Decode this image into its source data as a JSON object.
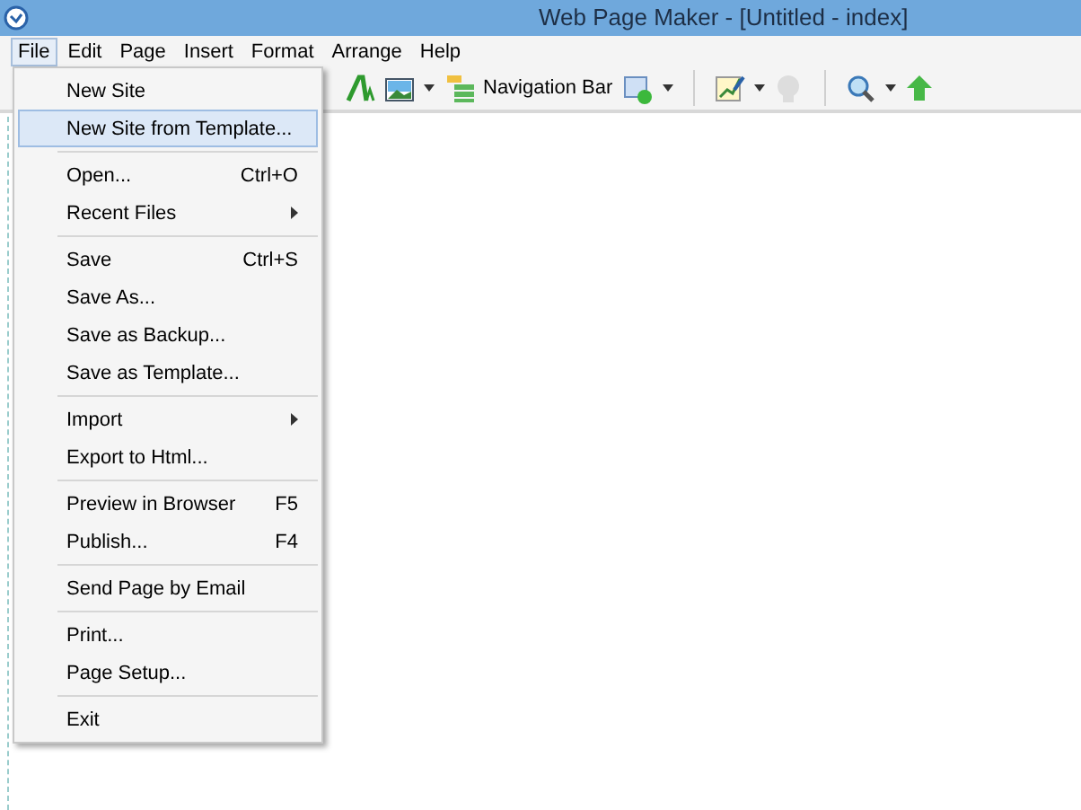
{
  "window": {
    "title": "Web Page Maker - [Untitled - index]"
  },
  "menubar": [
    {
      "label": "File",
      "selected": true
    },
    {
      "label": "Edit",
      "selected": false
    },
    {
      "label": "Page",
      "selected": false
    },
    {
      "label": "Insert",
      "selected": false
    },
    {
      "label": "Format",
      "selected": false
    },
    {
      "label": "Arrange",
      "selected": false
    },
    {
      "label": "Help",
      "selected": false
    }
  ],
  "toolbar": [
    {
      "kind": "icon"
    },
    {
      "kind": "icon"
    },
    {
      "kind": "caret"
    },
    {
      "kind": "labeled",
      "label": "Navigation Bar"
    },
    {
      "kind": "icon"
    },
    {
      "kind": "caret"
    },
    {
      "kind": "separator"
    },
    {
      "kind": "icon"
    },
    {
      "kind": "caret"
    },
    {
      "kind": "icon"
    },
    {
      "kind": "separator"
    },
    {
      "kind": "icon"
    },
    {
      "kind": "caret"
    },
    {
      "kind": "icon"
    }
  ],
  "file_menu": [
    {
      "kind": "item",
      "label": "New Site",
      "selected": false
    },
    {
      "kind": "item",
      "label": "New Site from Template...",
      "selected": true
    },
    {
      "kind": "separator"
    },
    {
      "kind": "item",
      "label": "Open...",
      "shortcut": "Ctrl+O",
      "selected": false
    },
    {
      "kind": "item",
      "label": "Recent Files",
      "submenu": true,
      "selected": false
    },
    {
      "kind": "separator"
    },
    {
      "kind": "item",
      "label": "Save",
      "shortcut": "Ctrl+S",
      "selected": false
    },
    {
      "kind": "item",
      "label": "Save As...",
      "selected": false
    },
    {
      "kind": "item",
      "label": "Save as Backup...",
      "selected": false
    },
    {
      "kind": "item",
      "label": "Save as Template...",
      "selected": false
    },
    {
      "kind": "separator"
    },
    {
      "kind": "item",
      "label": "Import",
      "submenu": true,
      "selected": false
    },
    {
      "kind": "item",
      "label": "Export to Html...",
      "selected": false
    },
    {
      "kind": "separator"
    },
    {
      "kind": "item",
      "label": "Preview in Browser",
      "shortcut": "F5",
      "selected": false
    },
    {
      "kind": "item",
      "label": "Publish...",
      "shortcut": "F4",
      "selected": false
    },
    {
      "kind": "separator"
    },
    {
      "kind": "item",
      "label": "Send Page by Email",
      "selected": false
    },
    {
      "kind": "separator"
    },
    {
      "kind": "item",
      "label": "Print...",
      "selected": false
    },
    {
      "kind": "item",
      "label": "Page Setup...",
      "selected": false
    },
    {
      "kind": "separator"
    },
    {
      "kind": "item",
      "label": "Exit",
      "selected": false
    }
  ]
}
